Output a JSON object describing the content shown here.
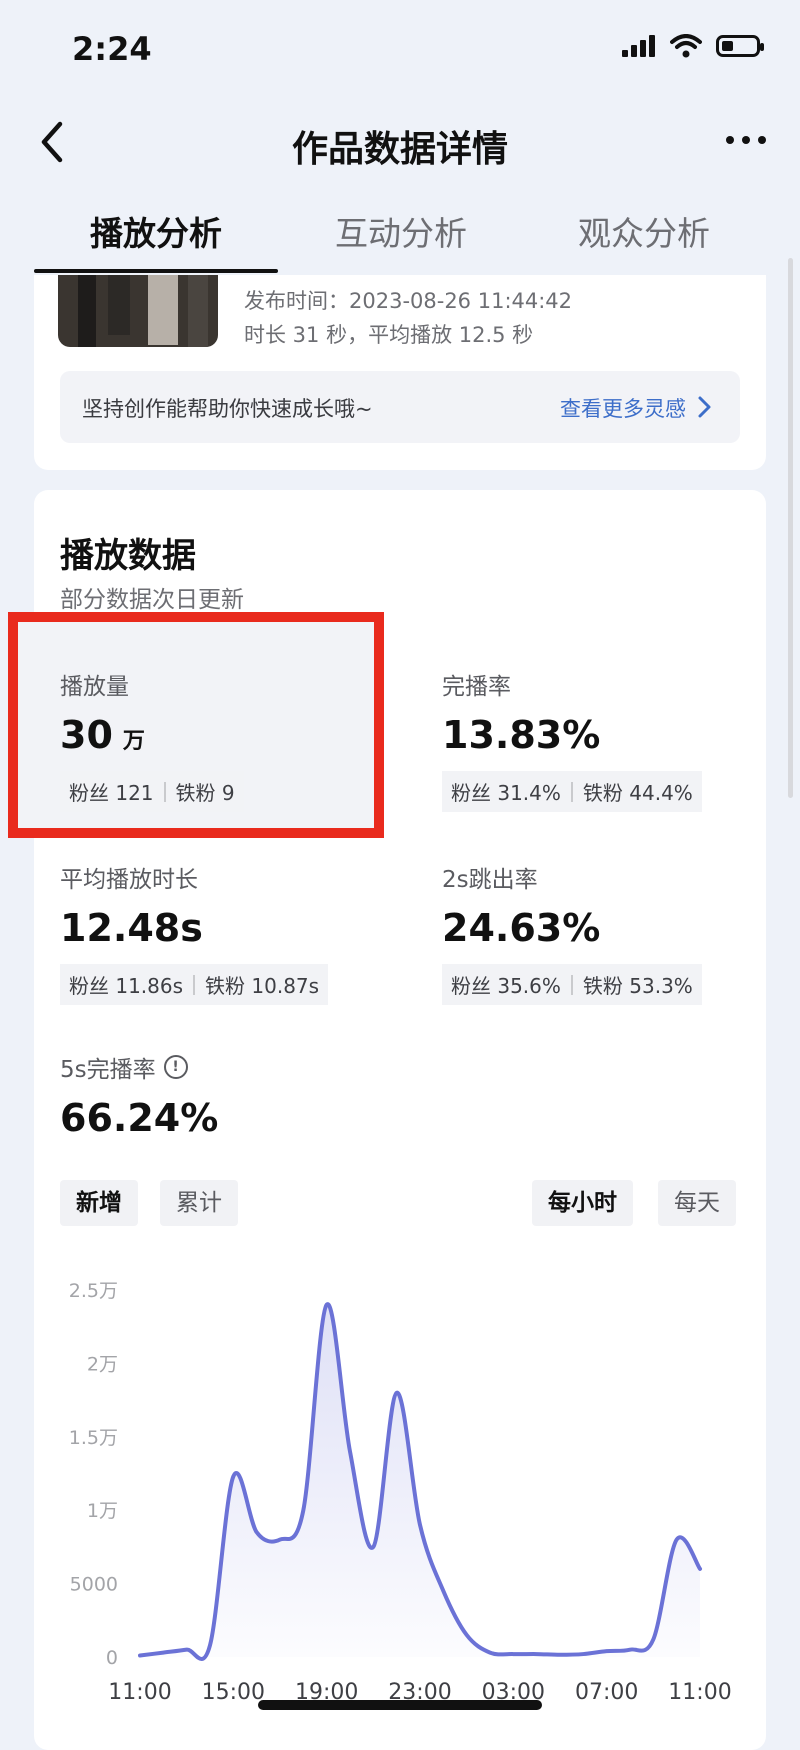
{
  "status_bar": {
    "time": "2:24",
    "battery_level": 0.35
  },
  "nav": {
    "title": "作品数据详情"
  },
  "tabs": [
    {
      "label": "播放分析",
      "active": true
    },
    {
      "label": "互动分析",
      "active": false
    },
    {
      "label": "观众分析",
      "active": false
    }
  ],
  "video": {
    "publish_time": "发布时间：2023-08-26 11:44:42",
    "duration": "时长 31 秒，平均播放 12.5 秒"
  },
  "tip": {
    "text": "坚持创作能帮助你快速成长哦~",
    "link": "查看更多灵感"
  },
  "section": {
    "title": "播放数据",
    "subtitle": "部分数据次日更新"
  },
  "metrics": {
    "plays": {
      "label": "播放量",
      "value": "30",
      "unit": "万",
      "fans": "粉丝 121",
      "iron": "铁粉 9"
    },
    "completion": {
      "label": "完播率",
      "value": "13.83%",
      "fans": "粉丝 31.4%",
      "iron": "铁粉 44.4%"
    },
    "avg_duration": {
      "label": "平均播放时长",
      "value": "12.48s",
      "fans": "粉丝 11.86s",
      "iron": "铁粉 10.87s"
    },
    "bounce": {
      "label": "2s跳出率",
      "value": "24.63%",
      "fans": "粉丝 35.6%",
      "iron": "铁粉 53.3%"
    },
    "five_sec": {
      "label": "5s完播率",
      "value": "66.24%"
    }
  },
  "toggles": {
    "left": [
      {
        "label": "新增",
        "active": true
      },
      {
        "label": "累计",
        "active": false
      }
    ],
    "right": [
      {
        "label": "每小时",
        "active": true
      },
      {
        "label": "每天",
        "active": false
      }
    ]
  },
  "colors": {
    "accent": "#6b72d6",
    "highlight_border": "#e92a1d",
    "link": "#3d6ec9"
  },
  "chart_data": {
    "type": "area",
    "x": [
      "11:00",
      "12:00",
      "13:00",
      "14:00",
      "15:00",
      "16:00",
      "17:00",
      "18:00",
      "19:00",
      "20:00",
      "21:00",
      "22:00",
      "23:00",
      "00:00",
      "01:00",
      "02:00",
      "03:00",
      "04:00",
      "05:00",
      "06:00",
      "07:00",
      "08:00",
      "09:00",
      "10:00",
      "11:00"
    ],
    "x_ticks": [
      "11:00",
      "15:00",
      "19:00",
      "23:00",
      "03:00",
      "07:00",
      "11:00"
    ],
    "y_ticks": [
      "0",
      "5000",
      "1万",
      "1.5万",
      "2万",
      "2.5万"
    ],
    "ylim": [
      0,
      25000
    ],
    "values": [
      100,
      300,
      500,
      800,
      12300,
      8500,
      8000,
      10000,
      24000,
      14000,
      7500,
      18000,
      9000,
      4500,
      1500,
      300,
      200,
      200,
      150,
      200,
      400,
      500,
      1200,
      8000,
      6000
    ],
    "grid": false
  }
}
